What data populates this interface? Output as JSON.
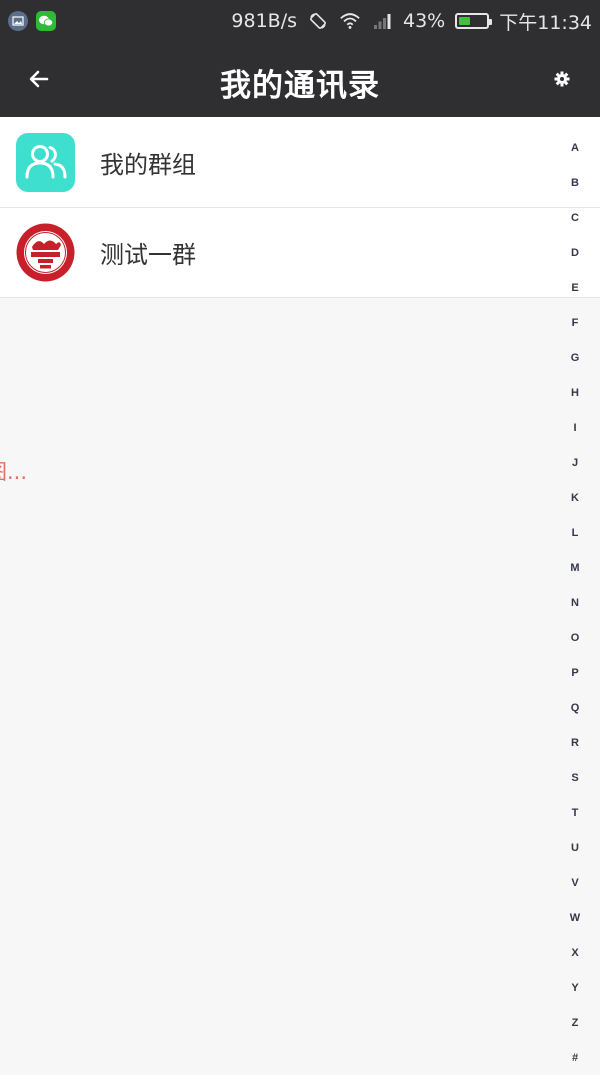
{
  "status_bar": {
    "speed": "981B/s",
    "battery_pct": "43%",
    "battery_level": 0.43,
    "time": "下午11:34",
    "icons": [
      "gallery-icon",
      "wechat-icon",
      "rotate-icon",
      "wifi-icon",
      "signal-icon",
      "battery-icon"
    ]
  },
  "header": {
    "title": "我的通讯录",
    "back_icon": "arrow-left-icon",
    "settings_icon": "gear-icon"
  },
  "contacts": [
    {
      "label": "我的群组",
      "icon": "group-icon"
    },
    {
      "label": "测试一群",
      "icon": "org-logo-icon"
    }
  ],
  "index_letters": [
    "A",
    "B",
    "C",
    "D",
    "E",
    "F",
    "G",
    "H",
    "I",
    "J",
    "K",
    "L",
    "M",
    "N",
    "O",
    "P",
    "Q",
    "R",
    "S",
    "T",
    "U",
    "V",
    "W",
    "X",
    "Y",
    "Z",
    "#"
  ],
  "overlay": {
    "loading_text": "图..."
  },
  "colors": {
    "header_bg": "#2f2f31",
    "group_avatar": "#3fdfcf",
    "logo_red": "#c8202a",
    "loading_text": "#e07060"
  }
}
